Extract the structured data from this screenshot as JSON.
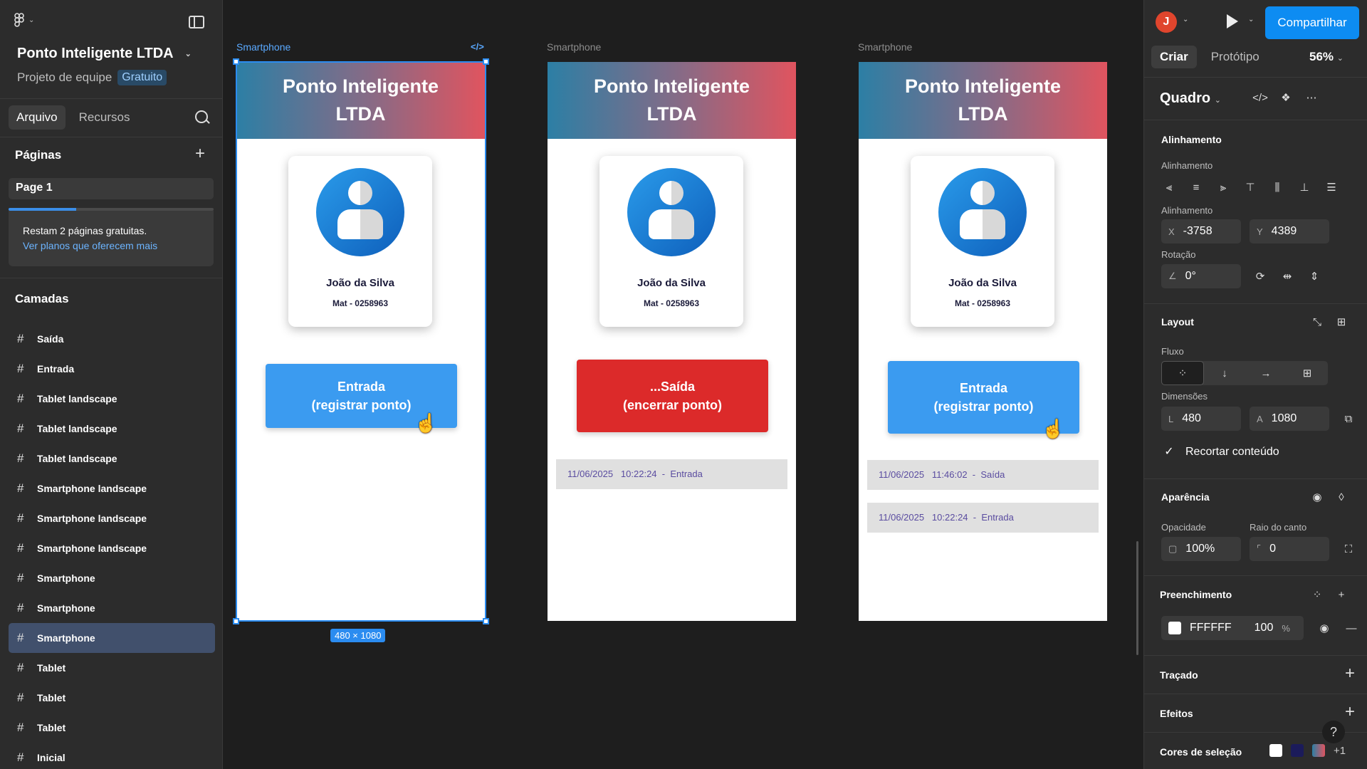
{
  "left": {
    "project_title": "Ponto Inteligente LTDA",
    "project_sub": "Projeto de equipe",
    "plan_badge": "Gratuito",
    "tabs": [
      "Arquivo",
      "Recursos"
    ],
    "pages_title": "Páginas",
    "page_item": "Page 1",
    "pages_progress": 0.33,
    "notice_text": "Restam 2 páginas gratuitas.",
    "notice_link": "Ver planos que oferecem mais",
    "layers_title": "Camadas",
    "layers": [
      "Saída",
      "Entrada",
      "Tablet landscape",
      "Tablet landscape",
      "Tablet landscape",
      "Smartphone landscape",
      "Smartphone landscape",
      "Smartphone landscape",
      "Smartphone",
      "Smartphone",
      "Smartphone",
      "Tablet",
      "Tablet",
      "Tablet",
      "Inicial"
    ],
    "selected_layer_index": 10
  },
  "canvas": {
    "frames": [
      {
        "label": "Smartphone",
        "title": "Ponto Inteligente LTDA",
        "name": "João da Silva",
        "mat": "Mat - 0258963",
        "button_line1": "Entrada",
        "button_line2": "(registrar ponto)",
        "button_color": "blue",
        "logs": []
      },
      {
        "label": "Smartphone",
        "title": "Ponto Inteligente LTDA",
        "name": "João da Silva",
        "mat": "Mat - 0258963",
        "button_line1": "...Saída",
        "button_line2": "(encerrar ponto)",
        "button_color": "red",
        "logs": [
          "11/06/2025   10:22:24  -  Entrada"
        ]
      },
      {
        "label": "Smartphone",
        "title": "Ponto Inteligente LTDA",
        "name": "João da Silva",
        "mat": "Mat - 0258963",
        "button_line1": "Entrada",
        "button_line2": "(registrar ponto)",
        "button_color": "blue",
        "logs": [
          "11/06/2025   11:46:02  -  Saída",
          "11/06/2025   10:22:24  -  Entrada"
        ]
      }
    ],
    "code_icon": "</>",
    "selection_size": "480 × 1080"
  },
  "right": {
    "user_initial": "J",
    "share_label": "Compartilhar",
    "tabs": [
      "Criar",
      "Protótipo"
    ],
    "zoom": "56%",
    "frame_type": "Quadro",
    "alignment_title": "Alinhamento",
    "alignment_label": "Alinhamento",
    "position_label": "Alinhamento",
    "x_label": "X",
    "x_value": "-3758",
    "y_label": "Y",
    "y_value": "4389",
    "rotation_label": "Rotação",
    "rotation_value": "0°",
    "layout_title": "Layout",
    "flow_label": "Fluxo",
    "dimensions_label": "Dimensões",
    "w_label": "L",
    "w_value": "480",
    "h_label": "A",
    "h_value": "1080",
    "clip_label": "Recortar conteúdo",
    "appearance_title": "Aparência",
    "opacity_label": "Opacidade",
    "opacity_value": "100%",
    "radius_label": "Raio do canto",
    "radius_value": "0",
    "fill_title": "Preenchimento",
    "fill_hex": "FFFFFF",
    "fill_opacity": "100",
    "fill_pct": "%",
    "stroke_title": "Traçado",
    "effects_title": "Efeitos",
    "selection_colors_title": "Cores de seleção",
    "selection_colors_more": "+1",
    "colors": {
      "accent": "#0d8cf2",
      "red_button": "#dc2a2a",
      "blue_button": "#3b9bf0",
      "swatch_white": "#ffffff",
      "swatch_navy": "#1b1b5a"
    }
  }
}
